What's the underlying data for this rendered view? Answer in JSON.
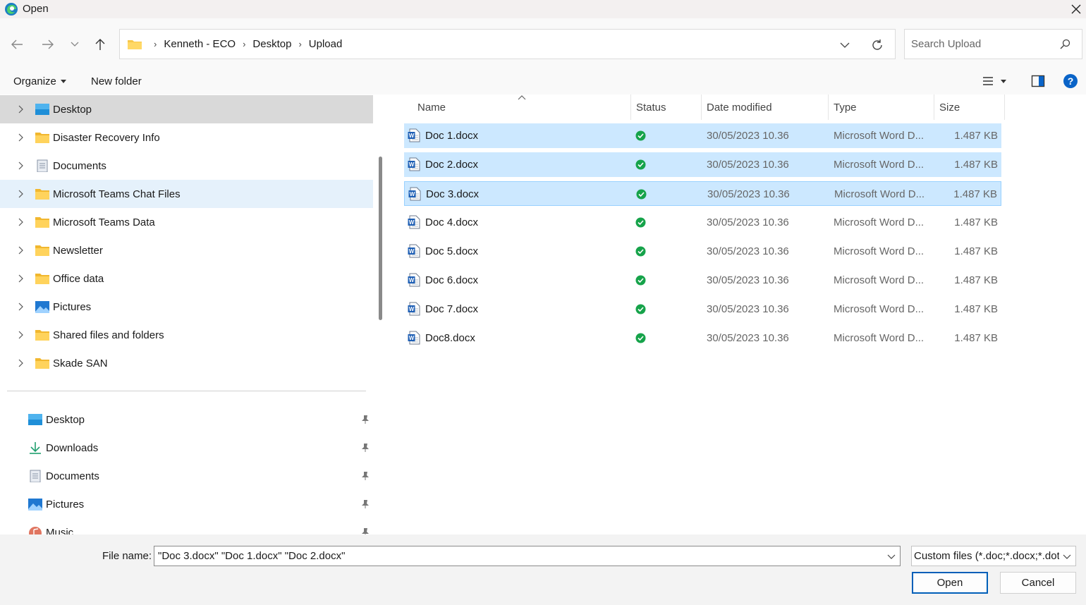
{
  "window": {
    "title": "Open",
    "close_icon": "close-icon",
    "app_icon": "edge-icon"
  },
  "nav": {
    "back_icon": "arrow-left-icon",
    "forward_icon": "arrow-right-icon",
    "recent_icon": "chevron-down-icon",
    "up_icon": "arrow-up-icon",
    "breadcrumbs": [
      "Kenneth - ECO",
      "Desktop",
      "Upload"
    ],
    "search_placeholder": "Search Upload"
  },
  "commandbar": {
    "organize_label": "Organize",
    "new_folder_label": "New folder"
  },
  "tree": [
    {
      "label": "Desktop",
      "icon": "desktop-icon",
      "state": "selected"
    },
    {
      "label": "Disaster Recovery Info",
      "icon": "folder-icon",
      "state": ""
    },
    {
      "label": "Documents",
      "icon": "documents-icon",
      "state": ""
    },
    {
      "label": "Microsoft Teams Chat Files",
      "icon": "folder-icon",
      "state": "hover"
    },
    {
      "label": "Microsoft Teams Data",
      "icon": "folder-icon",
      "state": ""
    },
    {
      "label": "Newsletter",
      "icon": "folder-icon",
      "state": ""
    },
    {
      "label": "Office data",
      "icon": "folder-icon",
      "state": ""
    },
    {
      "label": "Pictures",
      "icon": "pictures-icon",
      "state": ""
    },
    {
      "label": "Shared files and folders",
      "icon": "folder-icon",
      "state": ""
    },
    {
      "label": "Skade SAN",
      "icon": "folder-icon",
      "state": ""
    }
  ],
  "quick_access": [
    {
      "label": "Desktop",
      "icon": "desktop-icon"
    },
    {
      "label": "Downloads",
      "icon": "download-icon"
    },
    {
      "label": "Documents",
      "icon": "documents-icon"
    },
    {
      "label": "Pictures",
      "icon": "pictures-icon"
    },
    {
      "label": "Music",
      "icon": "music-icon"
    }
  ],
  "columns": {
    "name": "Name",
    "status": "Status",
    "date": "Date modified",
    "type": "Type",
    "size": "Size"
  },
  "files": [
    {
      "name": "Doc 1.docx",
      "date": "30/05/2023 10.36",
      "type": "Microsoft Word D...",
      "size": "1.487 KB",
      "selected": true,
      "focus": false
    },
    {
      "name": "Doc 2.docx",
      "date": "30/05/2023 10.36",
      "type": "Microsoft Word D...",
      "size": "1.487 KB",
      "selected": true,
      "focus": false
    },
    {
      "name": "Doc 3.docx",
      "date": "30/05/2023 10.36",
      "type": "Microsoft Word D...",
      "size": "1.487 KB",
      "selected": true,
      "focus": true
    },
    {
      "name": "Doc 4.docx",
      "date": "30/05/2023 10.36",
      "type": "Microsoft Word D...",
      "size": "1.487 KB",
      "selected": false,
      "focus": false
    },
    {
      "name": "Doc 5.docx",
      "date": "30/05/2023 10.36",
      "type": "Microsoft Word D...",
      "size": "1.487 KB",
      "selected": false,
      "focus": false
    },
    {
      "name": "Doc 6.docx",
      "date": "30/05/2023 10.36",
      "type": "Microsoft Word D...",
      "size": "1.487 KB",
      "selected": false,
      "focus": false
    },
    {
      "name": "Doc 7.docx",
      "date": "30/05/2023 10.36",
      "type": "Microsoft Word D...",
      "size": "1.487 KB",
      "selected": false,
      "focus": false
    },
    {
      "name": "Doc8.docx",
      "date": "30/05/2023 10.36",
      "type": "Microsoft Word D...",
      "size": "1.487 KB",
      "selected": false,
      "focus": false
    }
  ],
  "footer": {
    "file_name_label": "File name:",
    "file_name_value": "\"Doc 3.docx\" \"Doc 1.docx\" \"Doc 2.docx\"",
    "filter_value": "Custom files (*.doc;*.docx;*.dot;",
    "open_label": "Open",
    "cancel_label": "Cancel"
  },
  "colors": {
    "accent": "#005fb8",
    "selection": "#cce8ff",
    "status_ok": "#16a34a",
    "folder": "#f8c84a"
  }
}
